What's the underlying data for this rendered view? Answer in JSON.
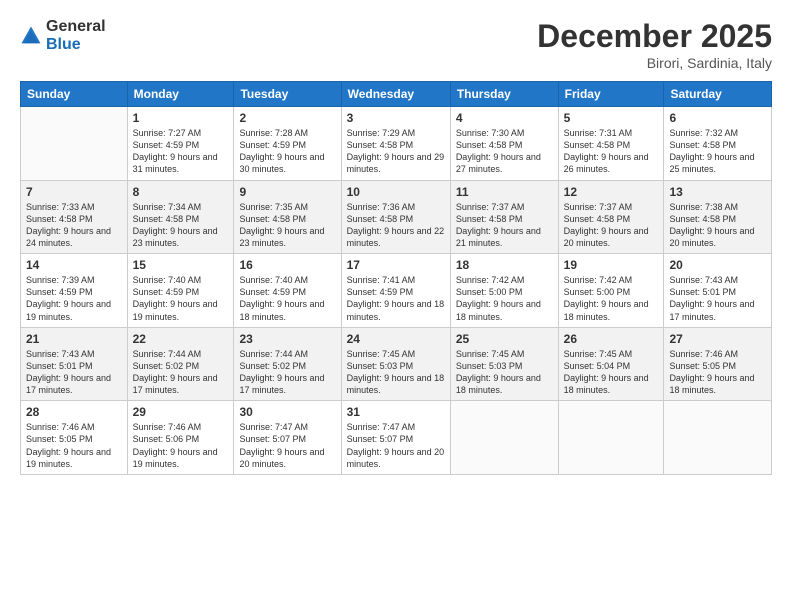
{
  "logo": {
    "general": "General",
    "blue": "Blue"
  },
  "header": {
    "month": "December 2025",
    "location": "Birori, Sardinia, Italy"
  },
  "days_of_week": [
    "Sunday",
    "Monday",
    "Tuesday",
    "Wednesday",
    "Thursday",
    "Friday",
    "Saturday"
  ],
  "weeks": [
    [
      {
        "day": "",
        "empty": true
      },
      {
        "day": "1",
        "sunrise": "Sunrise: 7:27 AM",
        "sunset": "Sunset: 4:59 PM",
        "daylight": "Daylight: 9 hours and 31 minutes."
      },
      {
        "day": "2",
        "sunrise": "Sunrise: 7:28 AM",
        "sunset": "Sunset: 4:59 PM",
        "daylight": "Daylight: 9 hours and 30 minutes."
      },
      {
        "day": "3",
        "sunrise": "Sunrise: 7:29 AM",
        "sunset": "Sunset: 4:58 PM",
        "daylight": "Daylight: 9 hours and 29 minutes."
      },
      {
        "day": "4",
        "sunrise": "Sunrise: 7:30 AM",
        "sunset": "Sunset: 4:58 PM",
        "daylight": "Daylight: 9 hours and 27 minutes."
      },
      {
        "day": "5",
        "sunrise": "Sunrise: 7:31 AM",
        "sunset": "Sunset: 4:58 PM",
        "daylight": "Daylight: 9 hours and 26 minutes."
      },
      {
        "day": "6",
        "sunrise": "Sunrise: 7:32 AM",
        "sunset": "Sunset: 4:58 PM",
        "daylight": "Daylight: 9 hours and 25 minutes."
      }
    ],
    [
      {
        "day": "7",
        "sunrise": "Sunrise: 7:33 AM",
        "sunset": "Sunset: 4:58 PM",
        "daylight": "Daylight: 9 hours and 24 minutes."
      },
      {
        "day": "8",
        "sunrise": "Sunrise: 7:34 AM",
        "sunset": "Sunset: 4:58 PM",
        "daylight": "Daylight: 9 hours and 23 minutes."
      },
      {
        "day": "9",
        "sunrise": "Sunrise: 7:35 AM",
        "sunset": "Sunset: 4:58 PM",
        "daylight": "Daylight: 9 hours and 23 minutes."
      },
      {
        "day": "10",
        "sunrise": "Sunrise: 7:36 AM",
        "sunset": "Sunset: 4:58 PM",
        "daylight": "Daylight: 9 hours and 22 minutes."
      },
      {
        "day": "11",
        "sunrise": "Sunrise: 7:37 AM",
        "sunset": "Sunset: 4:58 PM",
        "daylight": "Daylight: 9 hours and 21 minutes."
      },
      {
        "day": "12",
        "sunrise": "Sunrise: 7:37 AM",
        "sunset": "Sunset: 4:58 PM",
        "daylight": "Daylight: 9 hours and 20 minutes."
      },
      {
        "day": "13",
        "sunrise": "Sunrise: 7:38 AM",
        "sunset": "Sunset: 4:58 PM",
        "daylight": "Daylight: 9 hours and 20 minutes."
      }
    ],
    [
      {
        "day": "14",
        "sunrise": "Sunrise: 7:39 AM",
        "sunset": "Sunset: 4:59 PM",
        "daylight": "Daylight: 9 hours and 19 minutes."
      },
      {
        "day": "15",
        "sunrise": "Sunrise: 7:40 AM",
        "sunset": "Sunset: 4:59 PM",
        "daylight": "Daylight: 9 hours and 19 minutes."
      },
      {
        "day": "16",
        "sunrise": "Sunrise: 7:40 AM",
        "sunset": "Sunset: 4:59 PM",
        "daylight": "Daylight: 9 hours and 18 minutes."
      },
      {
        "day": "17",
        "sunrise": "Sunrise: 7:41 AM",
        "sunset": "Sunset: 4:59 PM",
        "daylight": "Daylight: 9 hours and 18 minutes."
      },
      {
        "day": "18",
        "sunrise": "Sunrise: 7:42 AM",
        "sunset": "Sunset: 5:00 PM",
        "daylight": "Daylight: 9 hours and 18 minutes."
      },
      {
        "day": "19",
        "sunrise": "Sunrise: 7:42 AM",
        "sunset": "Sunset: 5:00 PM",
        "daylight": "Daylight: 9 hours and 18 minutes."
      },
      {
        "day": "20",
        "sunrise": "Sunrise: 7:43 AM",
        "sunset": "Sunset: 5:01 PM",
        "daylight": "Daylight: 9 hours and 17 minutes."
      }
    ],
    [
      {
        "day": "21",
        "sunrise": "Sunrise: 7:43 AM",
        "sunset": "Sunset: 5:01 PM",
        "daylight": "Daylight: 9 hours and 17 minutes."
      },
      {
        "day": "22",
        "sunrise": "Sunrise: 7:44 AM",
        "sunset": "Sunset: 5:02 PM",
        "daylight": "Daylight: 9 hours and 17 minutes."
      },
      {
        "day": "23",
        "sunrise": "Sunrise: 7:44 AM",
        "sunset": "Sunset: 5:02 PM",
        "daylight": "Daylight: 9 hours and 17 minutes."
      },
      {
        "day": "24",
        "sunrise": "Sunrise: 7:45 AM",
        "sunset": "Sunset: 5:03 PM",
        "daylight": "Daylight: 9 hours and 18 minutes."
      },
      {
        "day": "25",
        "sunrise": "Sunrise: 7:45 AM",
        "sunset": "Sunset: 5:03 PM",
        "daylight": "Daylight: 9 hours and 18 minutes."
      },
      {
        "day": "26",
        "sunrise": "Sunrise: 7:45 AM",
        "sunset": "Sunset: 5:04 PM",
        "daylight": "Daylight: 9 hours and 18 minutes."
      },
      {
        "day": "27",
        "sunrise": "Sunrise: 7:46 AM",
        "sunset": "Sunset: 5:05 PM",
        "daylight": "Daylight: 9 hours and 18 minutes."
      }
    ],
    [
      {
        "day": "28",
        "sunrise": "Sunrise: 7:46 AM",
        "sunset": "Sunset: 5:05 PM",
        "daylight": "Daylight: 9 hours and 19 minutes."
      },
      {
        "day": "29",
        "sunrise": "Sunrise: 7:46 AM",
        "sunset": "Sunset: 5:06 PM",
        "daylight": "Daylight: 9 hours and 19 minutes."
      },
      {
        "day": "30",
        "sunrise": "Sunrise: 7:47 AM",
        "sunset": "Sunset: 5:07 PM",
        "daylight": "Daylight: 9 hours and 20 minutes."
      },
      {
        "day": "31",
        "sunrise": "Sunrise: 7:47 AM",
        "sunset": "Sunset: 5:07 PM",
        "daylight": "Daylight: 9 hours and 20 minutes."
      },
      {
        "day": "",
        "empty": true
      },
      {
        "day": "",
        "empty": true
      },
      {
        "day": "",
        "empty": true
      }
    ]
  ]
}
